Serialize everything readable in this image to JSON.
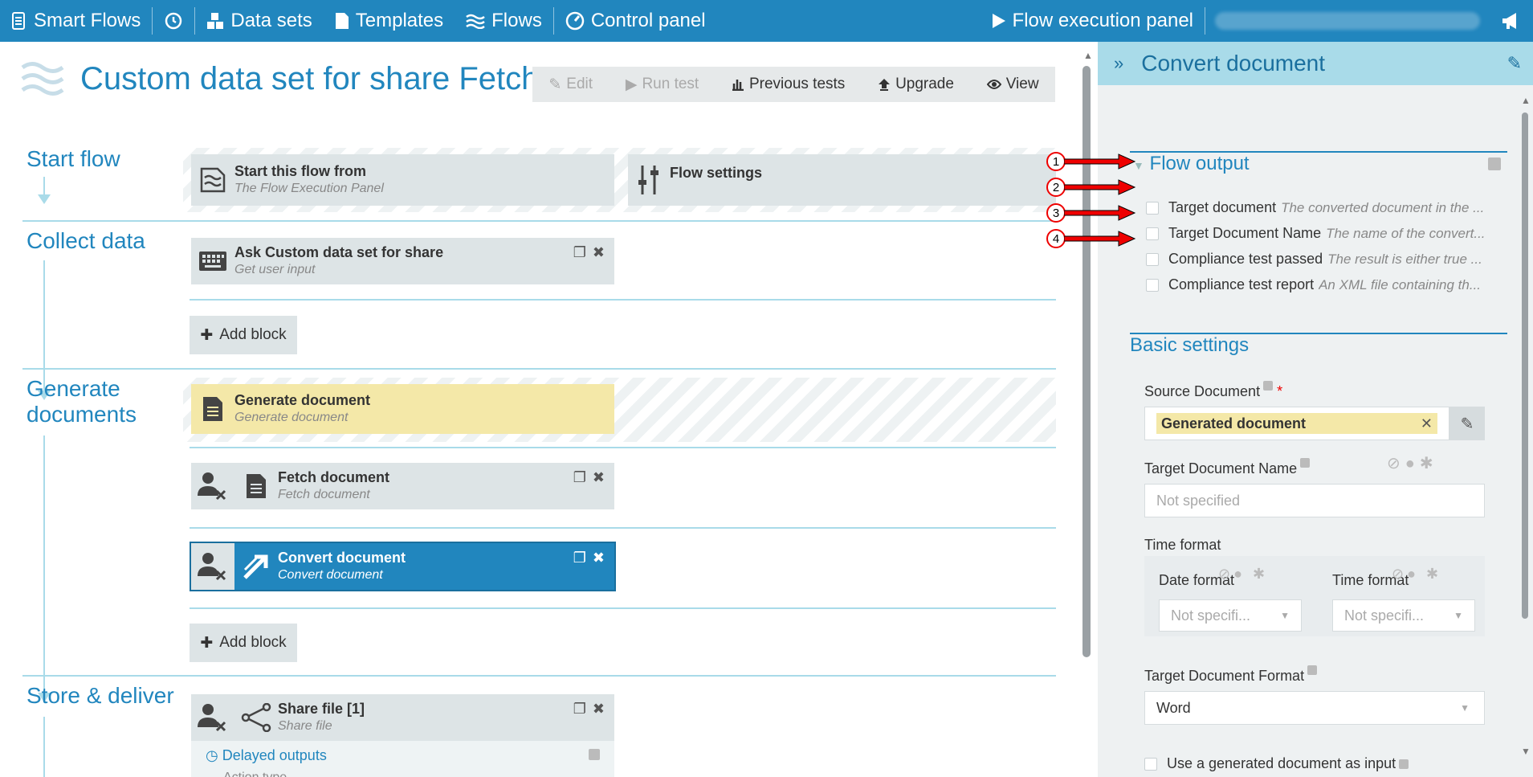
{
  "topbar": {
    "app": "Smart Flows",
    "datasets": "Data sets",
    "templates": "Templates",
    "flows": "Flows",
    "control_panel": "Control panel",
    "flow_exec": "Flow execution panel"
  },
  "page": {
    "title": "Custom data set for share Fetch",
    "actions": {
      "edit": "Edit",
      "run_test": "Run test",
      "previous_tests": "Previous tests",
      "upgrade": "Upgrade",
      "view": "View"
    }
  },
  "sections": {
    "start": "Start flow",
    "collect": "Collect data",
    "generate": "Generate documents",
    "store": "Store & deliver"
  },
  "blocks": {
    "start_from": {
      "title": "Start this flow from",
      "sub": "The Flow Execution Panel"
    },
    "flow_settings": {
      "title": "Flow settings"
    },
    "ask": {
      "title": "Ask Custom data set for share",
      "sub": "Get user input"
    },
    "generate": {
      "title": "Generate document",
      "sub": "Generate document"
    },
    "fetch": {
      "title": "Fetch document",
      "sub": "Fetch document"
    },
    "convert": {
      "title": "Convert document",
      "sub": "Convert document"
    },
    "share": {
      "title": "Share file [1]",
      "sub": "Share file"
    },
    "delayed": "Delayed outputs",
    "action_type": "Action type"
  },
  "add_block": "Add block",
  "panel": {
    "title": "Convert document",
    "flow_output": "Flow output",
    "outputs": [
      {
        "name": "Target document",
        "desc": "The converted document in the ..."
      },
      {
        "name": "Target Document Name",
        "desc": "The name of the convert..."
      },
      {
        "name": "Compliance test passed",
        "desc": "The result is either true ..."
      },
      {
        "name": "Compliance test report",
        "desc": "An XML file containing th..."
      }
    ],
    "callouts": [
      "1",
      "2",
      "3",
      "4"
    ],
    "basic_settings": "Basic settings",
    "source_doc_label": "Source Document",
    "required_mark": "*",
    "source_doc_value": "Generated document",
    "target_name_label": "Target Document Name",
    "target_name_placeholder": "Not specified",
    "time_format_label": "Time format",
    "date_format_label": "Date format",
    "time_format_sub_label": "Time format",
    "date_format_value": "Not specifi...",
    "time_format_value": "Not specifi...",
    "target_format_label": "Target Document Format",
    "target_format_value": "Word",
    "use_generated_label": "Use a generated document as input"
  },
  "colors": {
    "brand": "#2186be",
    "panel_head": "#a9dbe9",
    "highlight": "#f4e8a8",
    "selected": "#2186be"
  }
}
